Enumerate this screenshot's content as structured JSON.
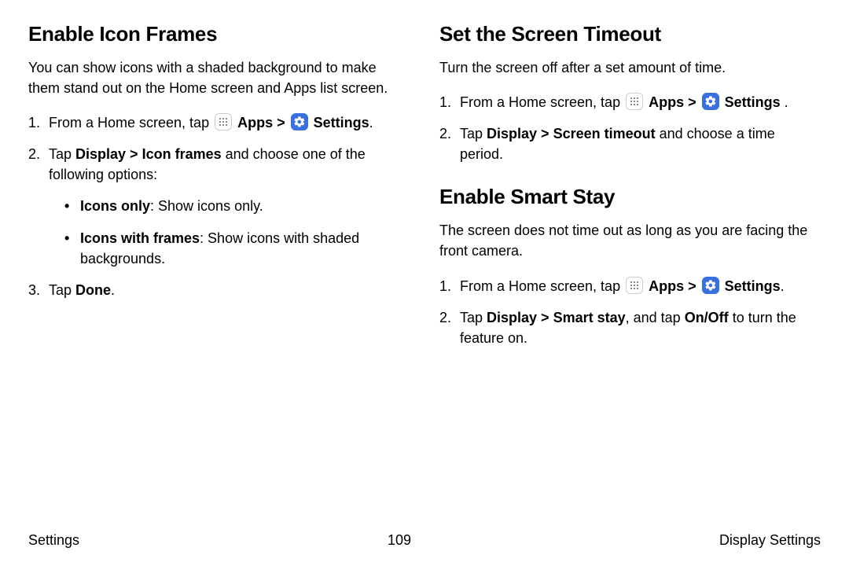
{
  "left": {
    "heading": "Enable Icon Frames",
    "intro": "You can show icons with a shaded background to make them stand out on the Home screen and Apps list screen.",
    "step1_a": "From a Home screen, tap ",
    "apps_label": "Apps",
    "chevron": " > ",
    "settings_label": "Settings",
    "period": ".",
    "step2_a": "Tap ",
    "step2_b": "Display > Icon frames",
    "step2_c": " and choose one of the following options:",
    "bullet1_a": "Icons only",
    "bullet1_b": ": Show icons only.",
    "bullet2_a": "Icons with frames",
    "bullet2_b": ": Show icons with shaded backgrounds.",
    "step3_a": "Tap ",
    "step3_b": "Done",
    "step3_c": "."
  },
  "right1": {
    "heading": "Set the Screen Timeout",
    "intro": "Turn the screen off after a set amount of time.",
    "step1_a": "From a Home screen, tap ",
    "apps_label": "Apps",
    "chevron": " > ",
    "settings_label": "Settings",
    "space_period": " .",
    "step2_a": "Tap ",
    "step2_b": "Display > Screen timeout",
    "step2_c": " and choose a time period."
  },
  "right2": {
    "heading": "Enable Smart Stay",
    "intro": "The screen does not time out as long as you are facing the front camera.",
    "step1_a": "From a Home screen, tap ",
    "apps_label": "Apps",
    "chevron": " > ",
    "settings_label": "Settings",
    "period": ".",
    "step2_a": "Tap ",
    "step2_b": "Display > Smart stay",
    "step2_c": ", and tap ",
    "step2_d": "On/Off",
    "step2_e": " to turn the feature on."
  },
  "footer": {
    "left": "Settings",
    "center": "109",
    "right": "Display Settings"
  }
}
